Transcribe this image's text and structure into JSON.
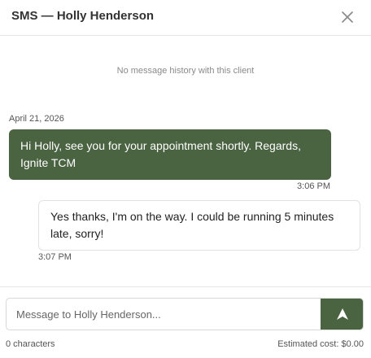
{
  "header": {
    "title": "SMS — Holly Henderson",
    "close_icon": "close-icon"
  },
  "conversation": {
    "empty_note": "No message history with this client",
    "date_label": "April 21, 2026",
    "messages": [
      {
        "direction": "outgoing",
        "text": "Hi Holly, see you for your appointment shortly. Regards, Ignite TCM",
        "time": "3:06 PM"
      },
      {
        "direction": "incoming",
        "text": "Yes thanks, I'm on the way. I could be running 5 minutes late, sorry!",
        "time": "3:07 PM"
      }
    ]
  },
  "composer": {
    "placeholder": "Message to Holly Henderson...",
    "value": "",
    "send_icon": "send-icon",
    "char_count": "0 characters",
    "estimated_cost": "Estimated cost: $0.00"
  },
  "colors": {
    "accent": "#4a6341",
    "outgoing_text": "#ffffff",
    "incoming_bg": "#ffffff",
    "muted_text": "#8a8a8a"
  }
}
